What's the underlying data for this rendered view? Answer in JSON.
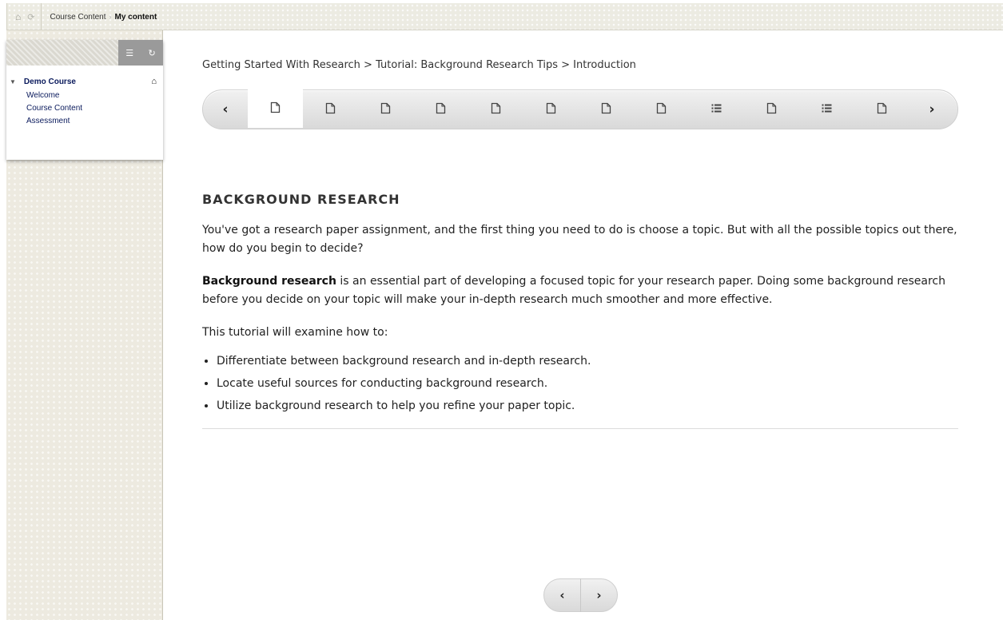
{
  "breadcrumb": {
    "items": [
      "Course Content",
      "My content"
    ]
  },
  "course_menu": {
    "title": "Demo Course",
    "items": [
      "Welcome",
      "Course Content",
      "Assessment"
    ]
  },
  "content_path": "Getting Started With Research > Tutorial: Background Research Tips > Introduction",
  "pager": {
    "prev_label": "‹",
    "next_label": "›",
    "pages": [
      {
        "icon": "page-icon",
        "active": true
      },
      {
        "icon": "page-icon"
      },
      {
        "icon": "page-icon"
      },
      {
        "icon": "page-icon"
      },
      {
        "icon": "page-icon"
      },
      {
        "icon": "page-icon"
      },
      {
        "icon": "page-icon"
      },
      {
        "icon": "page-icon"
      },
      {
        "icon": "list-icon"
      },
      {
        "icon": "page-icon"
      },
      {
        "icon": "list-icon"
      },
      {
        "icon": "page-icon"
      }
    ]
  },
  "article": {
    "heading": "BACKGROUND RESEARCH",
    "intro": "You've got a research paper assignment, and the first thing you need to do is choose a topic. But with all the possible topics out there, how do you begin to decide?",
    "bold_term": "Background research",
    "definition_rest": " is an essential part of developing a focused topic for your research paper. Doing some background research before you decide on your topic will make your in-depth research much smoother and more effective.",
    "lead_in": "This tutorial will examine how to:",
    "bullets": [
      "Differentiate between background research and in-depth research.",
      "Locate useful sources for conducting background research.",
      "Utilize background research to help you refine your paper topic."
    ]
  },
  "bottom_pager": {
    "prev_label": "‹",
    "next_label": "›"
  }
}
